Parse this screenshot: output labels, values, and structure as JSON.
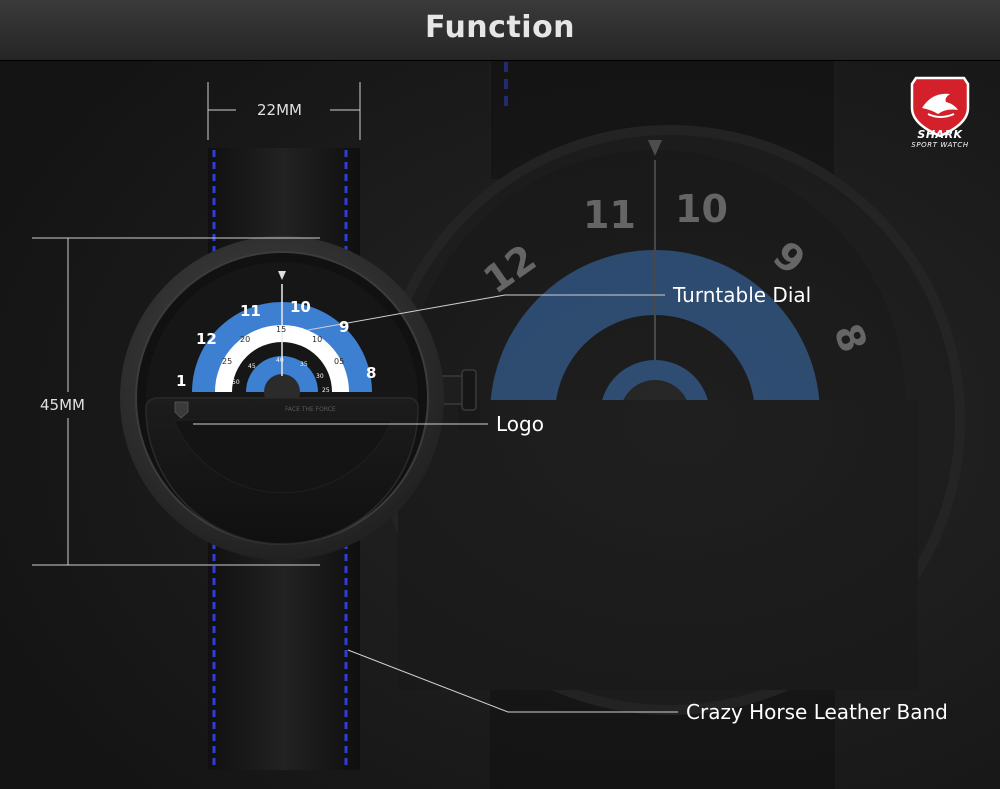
{
  "header": {
    "title": "Function"
  },
  "dimensions": {
    "width_label": "22MM",
    "height_label": "45MM"
  },
  "callouts": {
    "turntable": "Turntable Dial",
    "logo": "Logo",
    "band": "Crazy Horse Leather Band"
  },
  "brand": {
    "name": "SHARK",
    "tagline": "SPORT WATCH"
  },
  "dial": {
    "hour_numbers": [
      "1",
      "12",
      "11",
      "10",
      "9",
      "8"
    ],
    "minute_numbers": [
      "25",
      "20",
      "15",
      "10",
      "05"
    ],
    "inner_numbers": [
      "50",
      "45",
      "40",
      "35",
      "30",
      "25"
    ],
    "logo_text": "FACE THE FORCE"
  },
  "colors": {
    "accent_blue": "#3d7fd0",
    "stitch_blue": "#2f3fd6",
    "brand_red": "#d4202a"
  }
}
